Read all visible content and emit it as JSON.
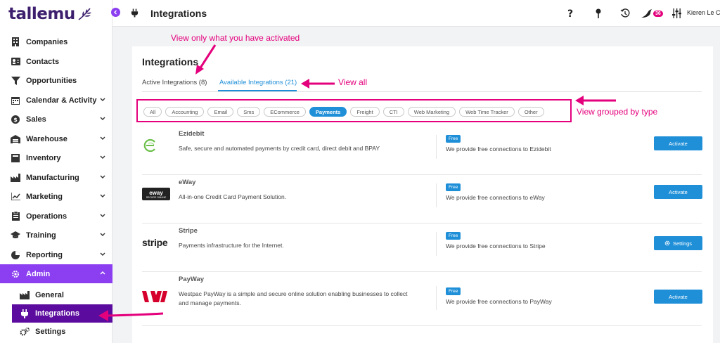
{
  "brand": {
    "name": "tallemu"
  },
  "sidebar": {
    "items": [
      {
        "label": "Companies",
        "icon": "building-icon",
        "expandable": false
      },
      {
        "label": "Contacts",
        "icon": "contact-card-icon",
        "expandable": false
      },
      {
        "label": "Opportunities",
        "icon": "funnel-icon",
        "expandable": false
      },
      {
        "label": "Calendar & Activity",
        "icon": "calendar-icon",
        "expandable": true
      },
      {
        "label": "Sales",
        "icon": "dollar-icon",
        "expandable": true
      },
      {
        "label": "Warehouse",
        "icon": "warehouse-icon",
        "expandable": true
      },
      {
        "label": "Inventory",
        "icon": "box-icon",
        "expandable": true
      },
      {
        "label": "Manufacturing",
        "icon": "factory-icon",
        "expandable": true
      },
      {
        "label": "Marketing",
        "icon": "chart-icon",
        "expandable": true
      },
      {
        "label": "Operations",
        "icon": "clipboard-icon",
        "expandable": true
      },
      {
        "label": "Training",
        "icon": "graduation-cap-icon",
        "expandable": true
      },
      {
        "label": "Reporting",
        "icon": "pie-chart-icon",
        "expandable": true
      },
      {
        "label": "Admin",
        "icon": "cog-icon",
        "expandable": true
      }
    ],
    "admin_sub": [
      {
        "label": "General"
      },
      {
        "label": "Integrations"
      },
      {
        "label": "Settings"
      }
    ]
  },
  "header": {
    "title": "Integrations",
    "notification_count": "36",
    "user_name": "Kieren Le Co"
  },
  "card": {
    "title": "Integrations",
    "tabs": [
      {
        "label": "Active Integrations (8)"
      },
      {
        "label": "Available Integrations (21)"
      }
    ],
    "filters": [
      "All",
      "Accounting",
      "Email",
      "Sms",
      "ECommerce",
      "Payments",
      "Freight",
      "CTI",
      "Web Marketing",
      "Web Time Tracker",
      "Other"
    ],
    "active_filter": "Payments",
    "integrations": [
      {
        "name": "Ezidebit",
        "description": "Safe, secure and automated payments by credit card, direct debit and BPAY",
        "badge": "Free",
        "provide": "We provide free connections to Ezidebit",
        "action": "Activate"
      },
      {
        "name": "eWay",
        "description": "All-in-one Credit Card Payment Solution.",
        "badge": "Free",
        "provide": "We provide free connections to eWay",
        "action": "Activate"
      },
      {
        "name": "Stripe",
        "description": "Payments infrastructure for the Internet.",
        "badge": "Free",
        "provide": "We provide free connections to Stripe",
        "action": "Settings"
      },
      {
        "name": "PayWay",
        "description": "Westpac PayWay is a simple and secure online solution enabling businesses to collect and manage payments.",
        "badge": "Free",
        "provide": "We provide free connections to PayWay",
        "action": "Activate"
      }
    ],
    "logo_text": {
      "eway": "eway",
      "eway_sub": "SECURE ONLINE",
      "stripe": "stripe"
    }
  },
  "annotations": {
    "activated": "View only what you have activated",
    "all": "View all",
    "grouped": "View grouped  by type"
  },
  "colors": {
    "accent": "#1f8fd8",
    "admin": "#8b3ff0",
    "active_sub": "#5b0c9e",
    "annotation": "#e4007c",
    "brand": "#3d1f6e"
  }
}
